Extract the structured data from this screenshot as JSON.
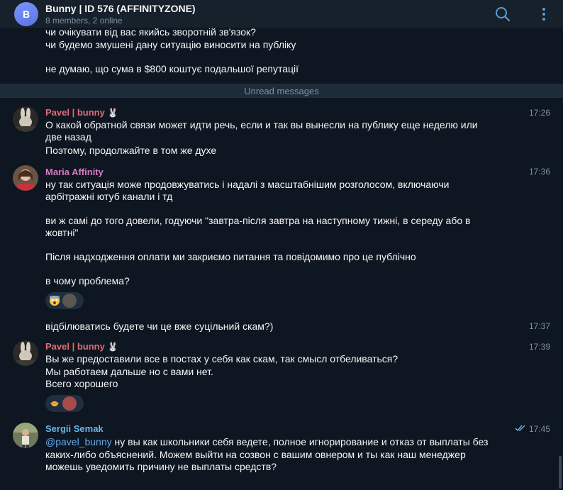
{
  "header": {
    "avatar_letter": "B",
    "title": "Bunny | ID 576 (AFFINITYZONE)",
    "subtitle": "8 members, 2 online",
    "icons": [
      "search-icon",
      "more-vertical-icon"
    ]
  },
  "previous": {
    "lines": [
      "чи очікувати від вас якийсь зворотній зв'язок?",
      "чи будемо змушені дану ситуацію виносити на публіку",
      "не думаю, що сума в $800 коштує подальшої репутації"
    ]
  },
  "unread_label": "Unread messages",
  "messages": [
    {
      "sender": "Pavel | bunny",
      "sender_badge": "rabbit-emoji",
      "time": "17:26",
      "lines": [
        "О какой обратной связи может идти речь, если и так вы вынесли на публику еще неделю или",
        "две назад",
        "Поэтому, продолжайте в том же духе"
      ]
    },
    {
      "sender": "Maria Affinity",
      "time": "17:36",
      "lines": [
        "ну так ситуація може продовжуватись і надалі з масштабнішим розголосом, включаючи",
        "арбітражні ютуб канали і тд",
        "ви ж самі до того довели, годуючи \"завтра-після завтра на наступному тижні, в середу або в",
        "жовтні\"",
        "Після надходження оплати ми закриємо питання та повідомимо про це публічно",
        "в чому проблема?"
      ],
      "reaction": "fear-emoji"
    },
    {
      "time": "17:37",
      "lines": [
        "відбілюватись будете чи це вже суцільний скам?)"
      ]
    },
    {
      "sender": "Pavel | bunny",
      "sender_badge": "rabbit-emoji",
      "time": "17:39",
      "lines": [
        "Вы же предоставили все в постах у себя как скам, так смысл отбеливаться?",
        "Мы работаем дальше но с вами нет.",
        "Всего хорошего"
      ],
      "reaction": "handshake-emoji"
    },
    {
      "sender": "Sergii Semak",
      "time": "17:45",
      "mention": "@pavel_bunny",
      "lines": [
        " ну вы как школьники себя ведете, полное игнорирование и отказ от выплаты без",
        "каких-либо объяснений. Можем выйти на созвон с вашим овнером и ты как наш менеджер",
        "можешь уведомить причину не выплаты средств?"
      ]
    }
  ],
  "colors": {
    "pavel": "#e26c77",
    "maria": "#d77ac1",
    "sergii": "#6cb4ea",
    "accent": "#5b9bd8",
    "time": "#7f91a4"
  }
}
